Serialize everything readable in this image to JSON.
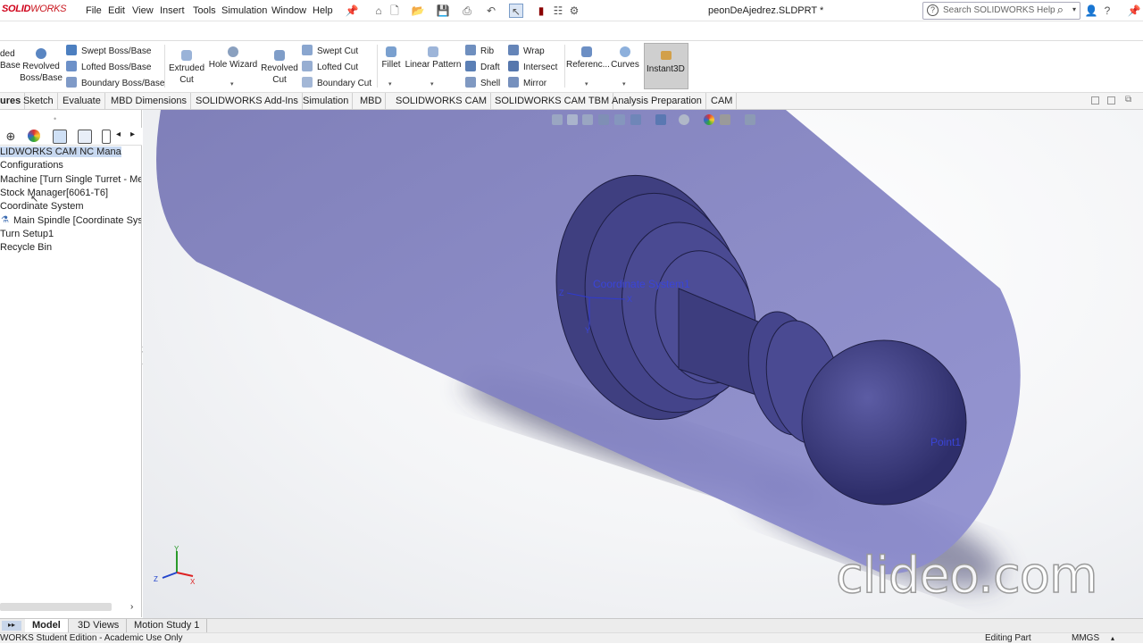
{
  "app": {
    "logo_bold": "SOLID",
    "logo_rest": "WORKS",
    "document_title": "peonDeAjedrez.SLDPRT *"
  },
  "menu": [
    "File",
    "Edit",
    "View",
    "Insert",
    "Tools",
    "Simulation",
    "Window",
    "Help"
  ],
  "search": {
    "placeholder": "Search SOLIDWORKS Help"
  },
  "commands": {
    "extruded_boss_partial": [
      "ded",
      "Base"
    ],
    "revolved_boss": [
      "Revolved",
      "Boss/Base"
    ],
    "swept_boss": "Swept Boss/Base",
    "lofted_boss": "Lofted Boss/Base",
    "boundary_boss": "Boundary Boss/Base",
    "extruded_cut": [
      "Extruded",
      "Cut"
    ],
    "hole_wizard": "Hole Wizard",
    "revolved_cut": [
      "Revolved",
      "Cut"
    ],
    "swept_cut": "Swept Cut",
    "lofted_cut": "Lofted Cut",
    "boundary_cut": "Boundary Cut",
    "fillet": "Fillet",
    "linear_pattern": "Linear Pattern",
    "rib": "Rib",
    "draft": "Draft",
    "shell": "Shell",
    "wrap": "Wrap",
    "intersect": "Intersect",
    "mirror": "Mirror",
    "reference": "Referenc...",
    "curves": "Curves",
    "instant3d": "Instant3D"
  },
  "tabs": [
    "ures",
    "Sketch",
    "Evaluate",
    "MBD Dimensions",
    "SOLIDWORKS Add-Ins",
    "Simulation",
    "MBD",
    "SOLIDWORKS CAM",
    "SOLIDWORKS CAM TBM",
    "Analysis Preparation",
    "CAM"
  ],
  "tree": [
    "LIDWORKS CAM NC Manager",
    "Configurations",
    "Machine [Turn Single Turret - Metr",
    "Stock Manager[6061-T6]",
    "Coordinate System",
    "Main Spindle [Coordinate Syste",
    "Turn Setup1",
    "Recycle Bin"
  ],
  "viewport": {
    "coord_label": "Coordinate System1",
    "point_label": "Point1",
    "axis_x": "X",
    "axis_y": "Y",
    "axis_z": "Z"
  },
  "bottom_tabs": [
    "Model",
    "3D Views",
    "Motion Study 1"
  ],
  "status": {
    "edition": "WORKS Student Edition - Academic Use Only",
    "mode": "Editing Part",
    "units": "MMGS"
  },
  "watermark": "clideo.com",
  "colors": {
    "accent": "#c9161e",
    "selection": "#c7d8f0",
    "part": "#4a4a8c",
    "stock": "#8a8ac8"
  }
}
